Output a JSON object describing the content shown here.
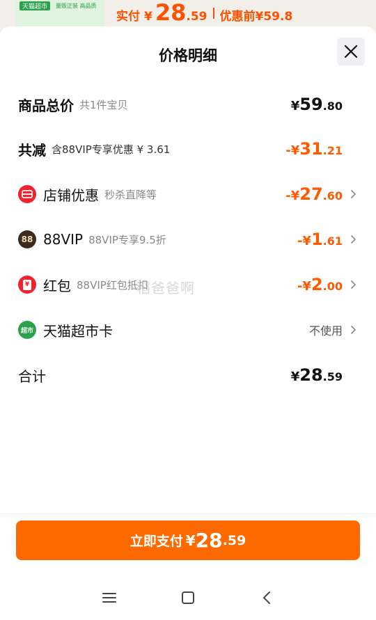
{
  "header_strip": {
    "thumb_tag": "天猫超市",
    "thumb_tag2": "量贩正装 高品质",
    "paid_label": "实付",
    "paid_currency": "¥",
    "paid_int": "28",
    "paid_dec": ".59",
    "before_label": "优惠前¥59.8"
  },
  "sheet": {
    "title": "价格明细",
    "close_icon": "close-icon"
  },
  "rows": {
    "total": {
      "label": "商品总价",
      "sub": "共1件宝贝",
      "currency": "¥",
      "int": "59",
      "dec": ".80"
    },
    "reduce": {
      "label": "共减",
      "sub": "含88VIP专享优惠 ¥ 3.61",
      "currency": "-¥",
      "int": "31",
      "dec": ".21"
    },
    "store": {
      "label": "店铺优惠",
      "sub": "秒杀直降等",
      "currency": "-¥",
      "int": "27",
      "dec": ".60",
      "icon": "store-discount-icon"
    },
    "vip": {
      "label": "88VIP",
      "sub": "88VIP专享9.5折",
      "currency": "-¥",
      "int": "1",
      "dec": ".61",
      "icon": "88vip-icon",
      "icon_text": "88"
    },
    "redpacket": {
      "label": "红包",
      "sub": "88VIP红包抵扣",
      "currency": "-¥",
      "int": "2",
      "dec": ".00",
      "icon": "red-packet-icon",
      "icon_text": "¥"
    },
    "card": {
      "label": "天猫超市卡",
      "value": "不使用",
      "icon": "tmall-supermarket-icon",
      "icon_text": "超市"
    },
    "sum": {
      "label": "合计",
      "currency": "¥",
      "int": "28",
      "dec": ".59"
    }
  },
  "watermark": "稻爸爸啊",
  "pay_button": {
    "label": "立即支付",
    "currency": "¥",
    "int": "28",
    "dec": ".59"
  },
  "navbar": {
    "menu_icon": "menu-icon",
    "home_icon": "home-icon",
    "back_icon": "back-icon"
  },
  "colors": {
    "accent": "#ff6a00",
    "discount": "#ff5a00",
    "text": "#111111",
    "sub": "#888888"
  }
}
